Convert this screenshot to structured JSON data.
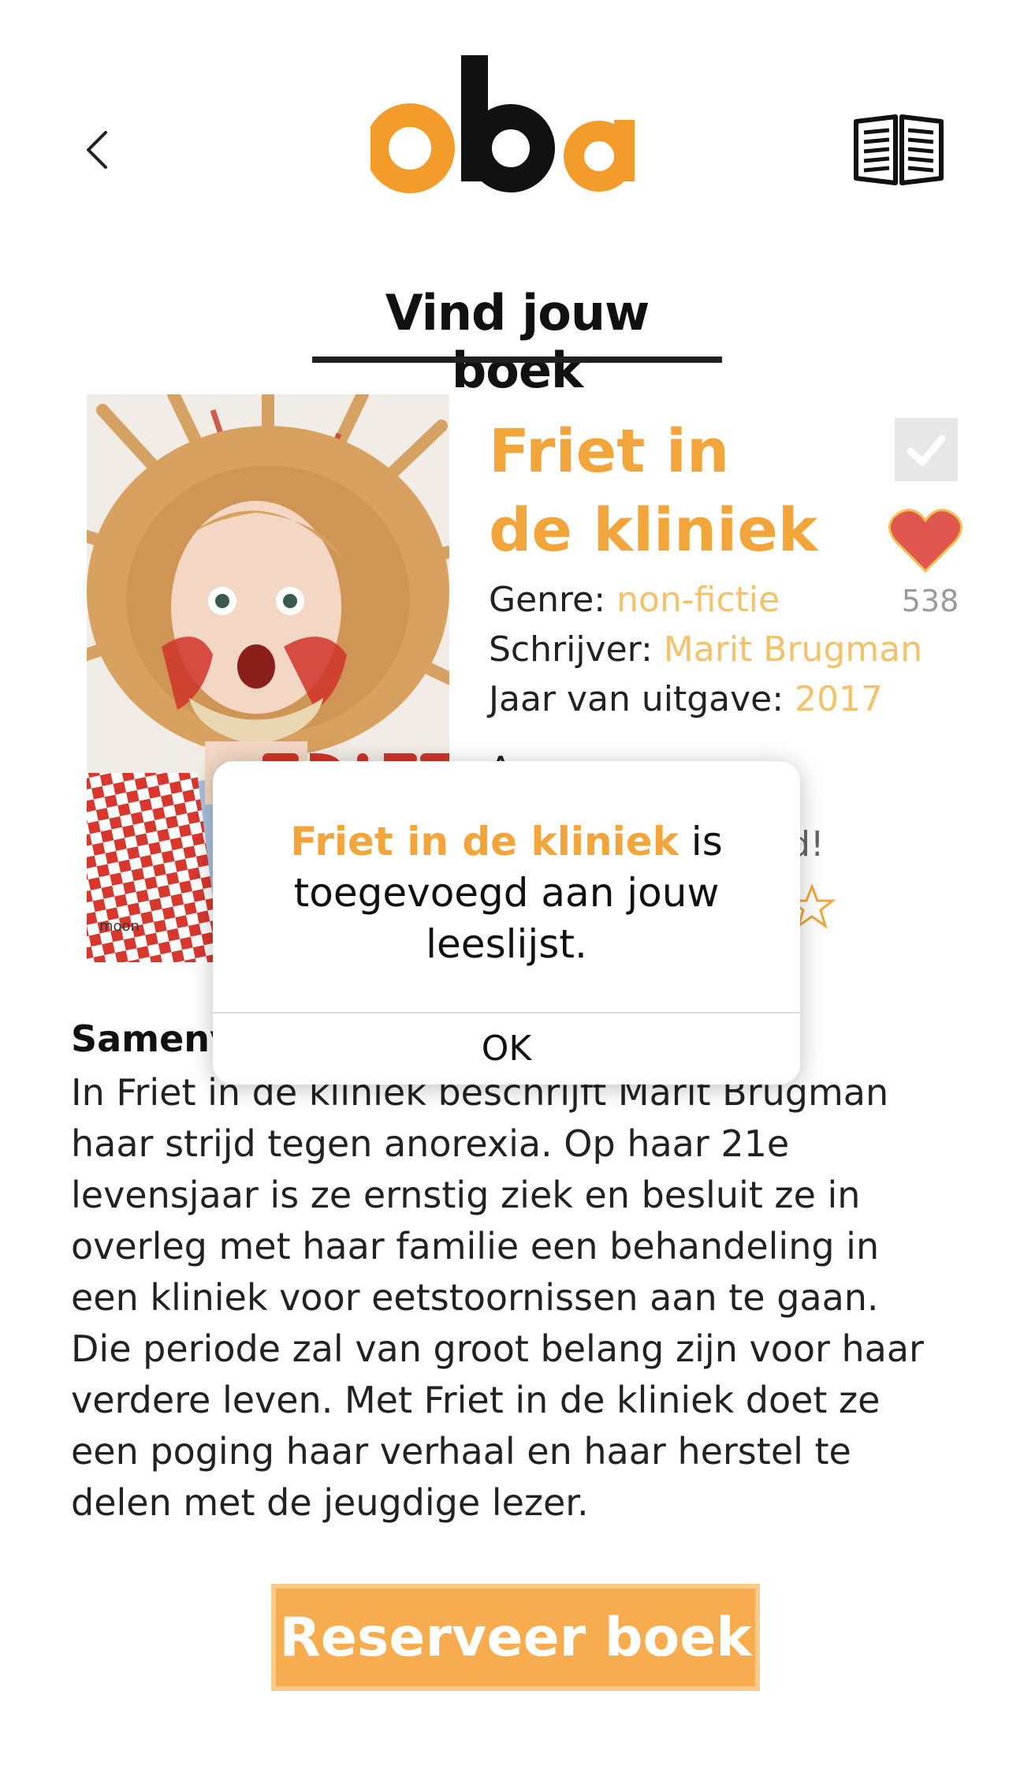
{
  "header": {
    "back_icon": "chevron-left-icon",
    "logo_text": "oba",
    "reader_icon": "open-book-icon"
  },
  "page": {
    "heading": "Vind jouw boek"
  },
  "book": {
    "title_line1": "Friet in",
    "title_line2": "de kliniek",
    "genre_label": "Genre:",
    "genre_value": "non-fictie",
    "author_label": "Schrijver:",
    "author_value": "Marit Brugman",
    "year_label": "Jaar van uitgave:",
    "year_value": "2017",
    "like_count": "538",
    "cover_publisher": "moon",
    "cover_title_partial": "FRIET"
  },
  "background_peek": {
    "line1": "A",
    "line2": "d!"
  },
  "summary": {
    "heading": "Samenv",
    "text": "In Friet in de kliniek beschrijft Marit Brugman haar strijd tegen anorexia. Op haar 21e levensjaar is ze ernstig ziek en besluit ze in overleg met haar familie een behandeling in een kliniek voor eetstoornissen aan te gaan. Die periode zal van groot belang zijn voor haar verdere leven. Met Friet in de kliniek doet ze een poging haar verhaal en haar herstel te delen met de jeugdige lezer."
  },
  "dialog": {
    "title": "Friet in de kliniek",
    "message_rest": " is toegevoegd aan jouw leeslijst.",
    "ok_label": "OK"
  },
  "actions": {
    "reserve_label": "Reserveer boek"
  },
  "colors": {
    "accent": "#f2a53a",
    "accent_light": "#f3c26b",
    "heart": "#e0574f",
    "button": "#f7ad4f"
  }
}
